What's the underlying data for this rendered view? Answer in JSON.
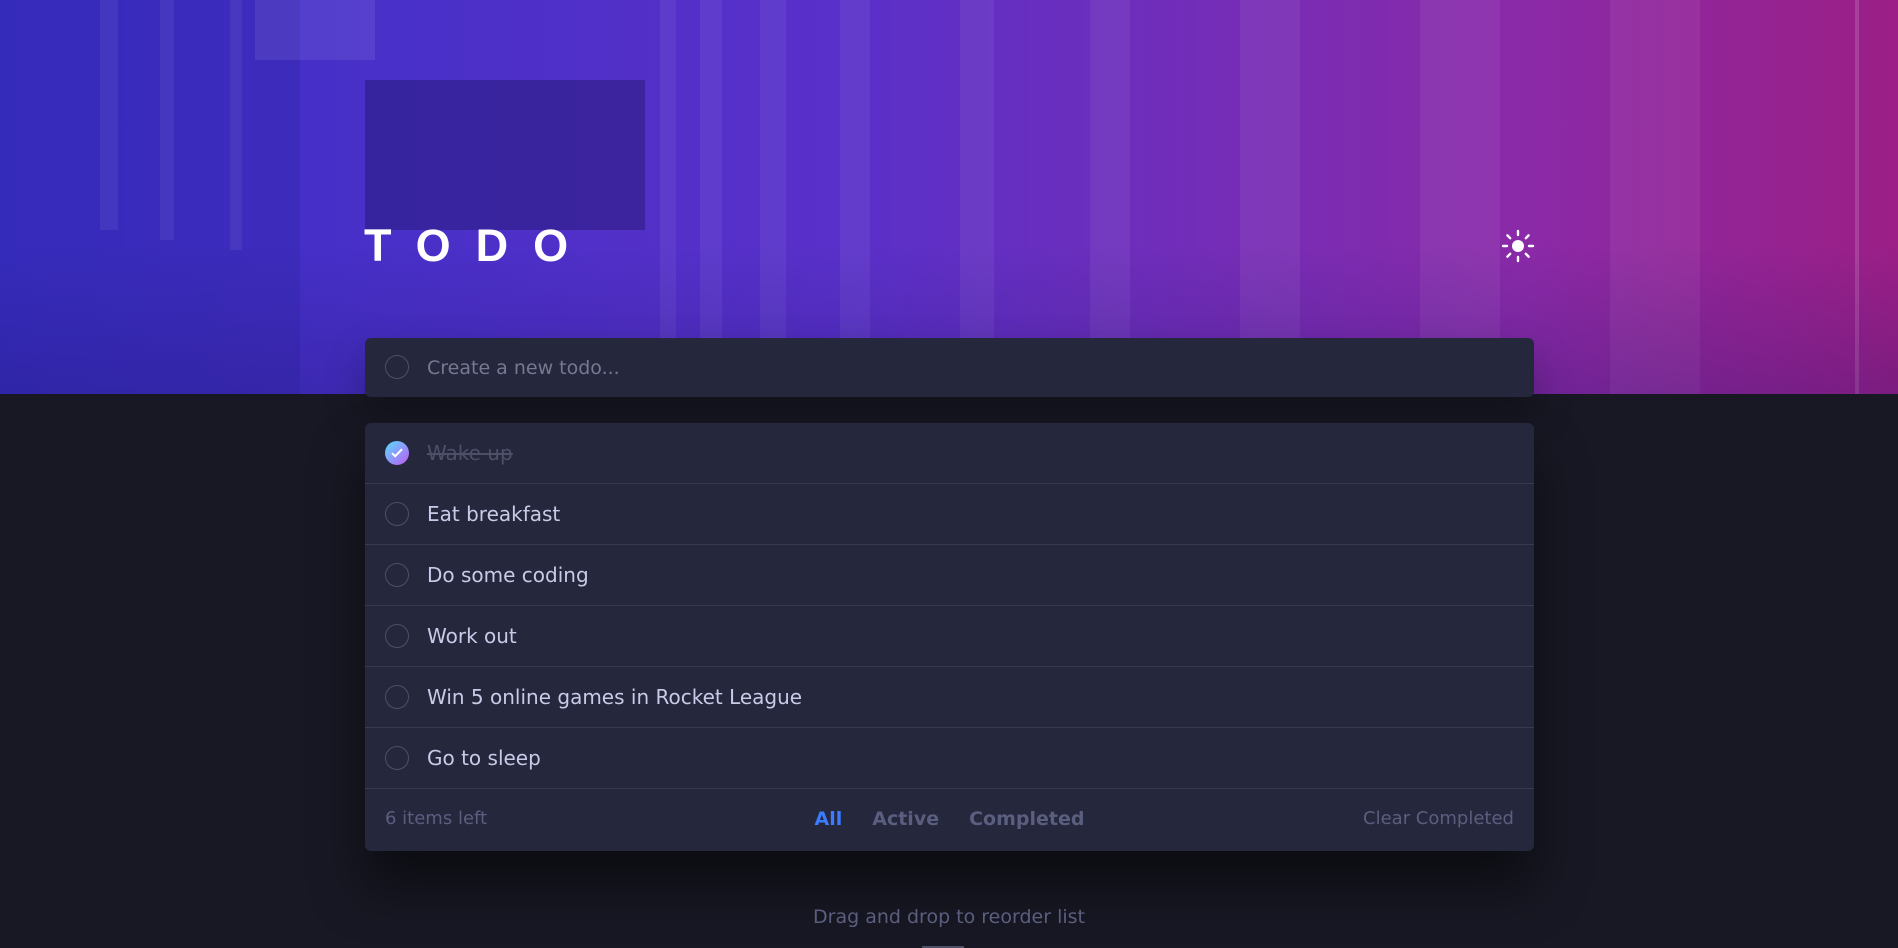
{
  "header": {
    "title": "TODO",
    "theme_icon": "sun-icon"
  },
  "new_todo": {
    "placeholder": "Create a new todo..."
  },
  "todos": [
    {
      "text": "Wake up",
      "completed": true
    },
    {
      "text": "Eat breakfast",
      "completed": false
    },
    {
      "text": "Do some coding",
      "completed": false
    },
    {
      "text": "Work out",
      "completed": false
    },
    {
      "text": "Win 5 online games in Rocket League",
      "completed": false
    },
    {
      "text": "Go to sleep",
      "completed": false
    }
  ],
  "footer": {
    "items_left": "6 items left",
    "filters": [
      "All",
      "Active",
      "Completed"
    ],
    "active_filter": "All",
    "clear_label": "Clear Completed"
  },
  "hint": "Drag and drop to reorder list",
  "colors": {
    "background": "#181824",
    "card": "#25273d",
    "text": "#c8cbe7",
    "muted": "#5b5e7e",
    "accent": "#3a7cfd",
    "check_gradient_start": "#57ddff",
    "check_gradient_end": "#c058f3"
  }
}
